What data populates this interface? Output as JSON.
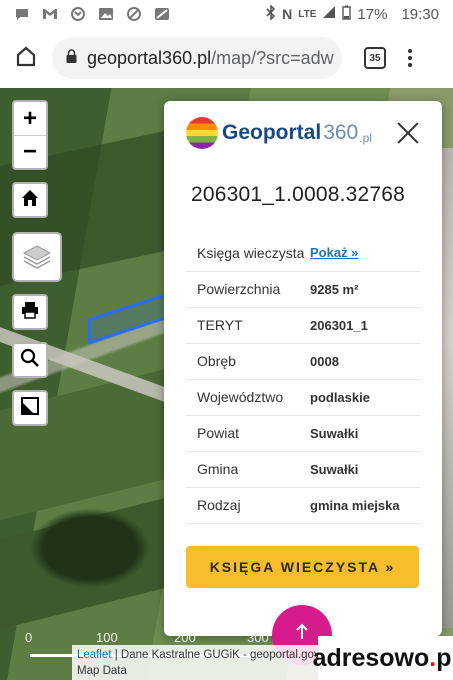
{
  "status_bar": {
    "battery": "17%",
    "time": "19:30",
    "network": "LTE"
  },
  "browser": {
    "url_host": "geoportal360.pl",
    "url_path": "/map/?src=adw",
    "tab_count": "35"
  },
  "map": {
    "zoom_in": "+",
    "zoom_out": "−",
    "scale_labels": [
      "0",
      "100",
      "200",
      "300"
    ],
    "attribution_link": "Leaflet",
    "attribution_text": " | Dane Kastralne GUGiK - geoportal.gov.pl",
    "map_data": "Map Data"
  },
  "popup": {
    "logo_text": "Geoportal",
    "logo_num": "360",
    "logo_tld": ".pl",
    "parcel_id": "206301_1.0008.32768",
    "rows": [
      {
        "label": "Księga wieczysta",
        "value": "Pokaż »",
        "link": true
      },
      {
        "label": "Powierzchnia",
        "value": "9285 m²",
        "link": false
      },
      {
        "label": "TERYT",
        "value": "206301_1",
        "link": false
      },
      {
        "label": "Obręb",
        "value": "0008",
        "link": false
      },
      {
        "label": "Województwo",
        "value": "podlaskie",
        "link": false
      },
      {
        "label": "Powiat",
        "value": "Suwałki",
        "link": false
      },
      {
        "label": "Gmina",
        "value": "Suwałki",
        "link": false
      },
      {
        "label": "Rodzaj",
        "value": "gmina miejska",
        "link": false
      }
    ],
    "button_label": "KSIĘGA WIECZYSTA »"
  },
  "watermark": {
    "text": "adresowo",
    "dot": ".",
    "tld": "pl"
  },
  "colors": {
    "accent_button": "#f7bd2a",
    "fab": "#d61b8c",
    "parcel_outline": "#2a6cff",
    "link": "#1a73b8"
  }
}
